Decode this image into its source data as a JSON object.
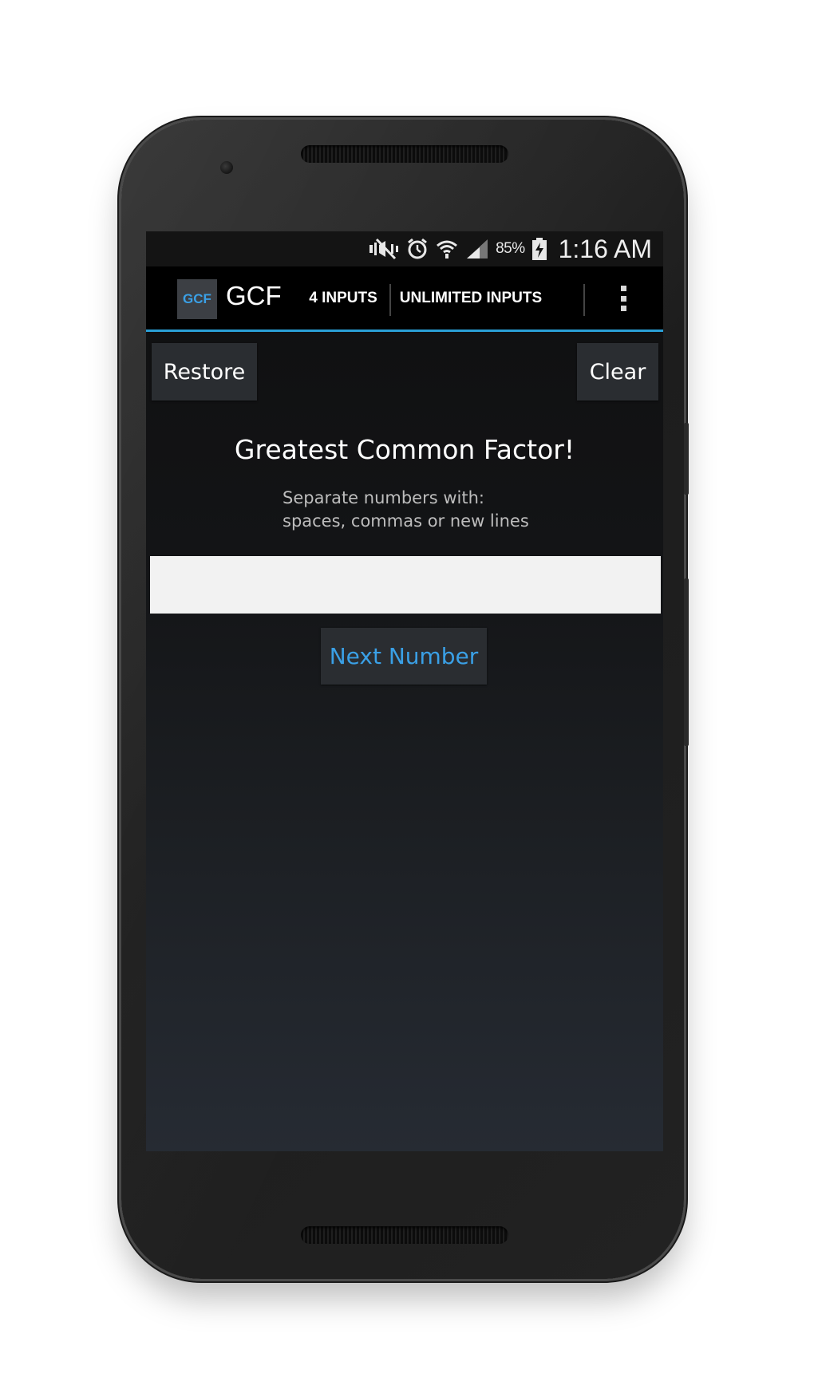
{
  "status_bar": {
    "icons": [
      "mute-icon",
      "alarm-icon",
      "wifi-icon",
      "signal-icon",
      "battery-charging-icon"
    ],
    "battery": "85%",
    "time": "1:16 AM"
  },
  "action_bar": {
    "logo_text": "GCF",
    "title": "GCF",
    "tabs": [
      {
        "label": "4 INPUTS"
      },
      {
        "label": "UNLIMITED INPUTS"
      }
    ],
    "overflow_icon": "more-vert-icon",
    "accent_color": "#2a9fd6"
  },
  "buttons": {
    "restore": "Restore",
    "clear": "Clear",
    "next": "Next Number"
  },
  "main": {
    "heading": "Greatest Common Factor!",
    "instruction_line1": "Separate numbers with:",
    "instruction_line2": "spaces, commas or new lines",
    "input_value": "",
    "input_placeholder": ""
  },
  "colors": {
    "link_blue": "#3aa0e6",
    "button_bg": "#2a2d31"
  }
}
